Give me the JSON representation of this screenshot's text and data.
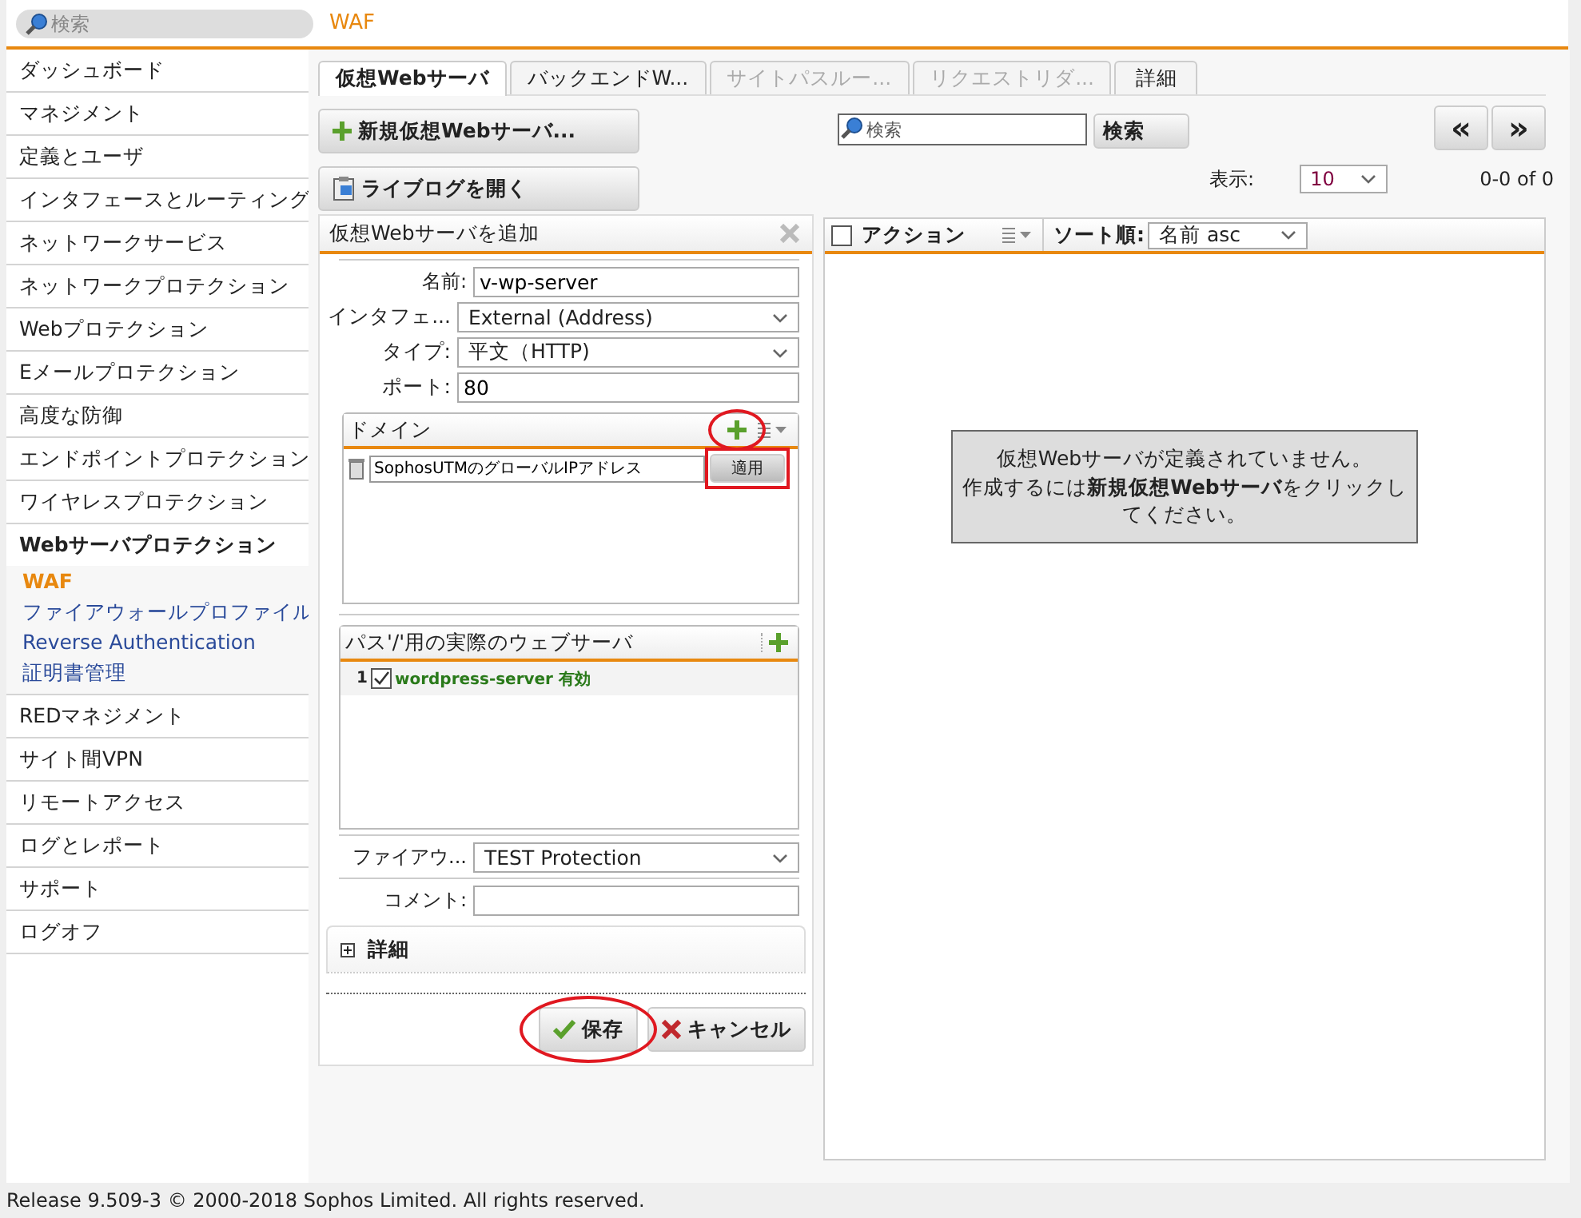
{
  "search": {
    "placeholder": "検索"
  },
  "breadcrumb": "WAF",
  "sidebar": {
    "items": [
      {
        "label": "ダッシュボード",
        "selected": false
      },
      {
        "label": "マネジメント",
        "selected": false
      },
      {
        "label": "定義とユーザ",
        "selected": false
      },
      {
        "label": "インタフェースとルーティング",
        "selected": false
      },
      {
        "label": "ネットワークサービス",
        "selected": false
      },
      {
        "label": "ネットワークプロテクション",
        "selected": false
      },
      {
        "label": "Webプロテクション",
        "selected": false
      },
      {
        "label": "Eメールプロテクション",
        "selected": false
      },
      {
        "label": "高度な防御",
        "selected": false
      },
      {
        "label": "エンドポイントプロテクション",
        "selected": false
      },
      {
        "label": "ワイヤレスプロテクション",
        "selected": false
      },
      {
        "label": "Webサーバプロテクション",
        "selected": true,
        "expanded": true,
        "children": [
          {
            "label": "WAF",
            "selected": true
          },
          {
            "label": "ファイアウォールプロファイル",
            "selected": false
          },
          {
            "label": "Reverse Authentication",
            "selected": false
          },
          {
            "label": "証明書管理",
            "selected": false
          }
        ]
      },
      {
        "label": "REDマネジメント",
        "selected": false
      },
      {
        "label": "サイト間VPN",
        "selected": false
      },
      {
        "label": "リモートアクセス",
        "selected": false
      },
      {
        "label": "ログとレポート",
        "selected": false
      },
      {
        "label": "サポート",
        "selected": false
      },
      {
        "label": "ログオフ",
        "selected": false
      }
    ]
  },
  "tabs": [
    {
      "label": "仮想Webサーバ",
      "selected": true,
      "disabled": false
    },
    {
      "label": "バックエンドW...",
      "selected": false,
      "disabled": false
    },
    {
      "label": "サイトパスルー...",
      "selected": false,
      "disabled": true
    },
    {
      "label": "リクエストリダ...",
      "selected": false,
      "disabled": true
    },
    {
      "label": "詳細",
      "selected": false,
      "disabled": false
    }
  ],
  "toolbar": {
    "new_button": "新規仮想Webサーバ...",
    "livelog_button": "ライブログを開く",
    "search": {
      "placeholder": "検索"
    },
    "search_button": "検索",
    "prev": "«",
    "next": "»",
    "show_label": "表示:",
    "page_size": "10",
    "range": "0-0 of 0"
  },
  "form": {
    "title": "仮想Webサーバを追加",
    "fields": [
      {
        "kind": "text",
        "label": "名前:",
        "value": "v-wp-server"
      },
      {
        "kind": "select",
        "label": "インタフェ...",
        "value": "External (Address)"
      },
      {
        "kind": "select",
        "label": "タイプ:",
        "value": "平文（HTTP)"
      },
      {
        "kind": "text",
        "label": "ポート:",
        "value": "80"
      }
    ],
    "domains": {
      "title": "ドメイン",
      "add_highlighted": true,
      "entries": [
        {
          "value": "SophosUTMのグローバルIPアドレス",
          "apply": "適用",
          "apply_highlighted": true
        }
      ]
    },
    "servers": {
      "title": "パス'/'用の実際のウェブサーバ",
      "rows": [
        {
          "index": "1",
          "checked": true,
          "name": "wordpress-server",
          "status": "有効"
        }
      ]
    },
    "firewall": {
      "label": "ファイアウ...",
      "value": "TEST Protection"
    },
    "comment": {
      "label": "コメント:"
    },
    "advanced": {
      "label": "詳細",
      "expanded": false
    },
    "save": {
      "label": "保存",
      "highlighted": true
    },
    "cancel": "キャンセル"
  },
  "list": {
    "action_label": "アクション",
    "all_checked": false,
    "sort_label": "ソート順:",
    "sort_value": "名前 asc",
    "empty_message": [
      "仮想Webサーバが定義されていません。",
      "作成するには**新規仮想Webサーバ**をクリックしてください。"
    ]
  },
  "footer": "Release 9.509-3  © 2000-2018 Sophos Limited. All rights reserved."
}
